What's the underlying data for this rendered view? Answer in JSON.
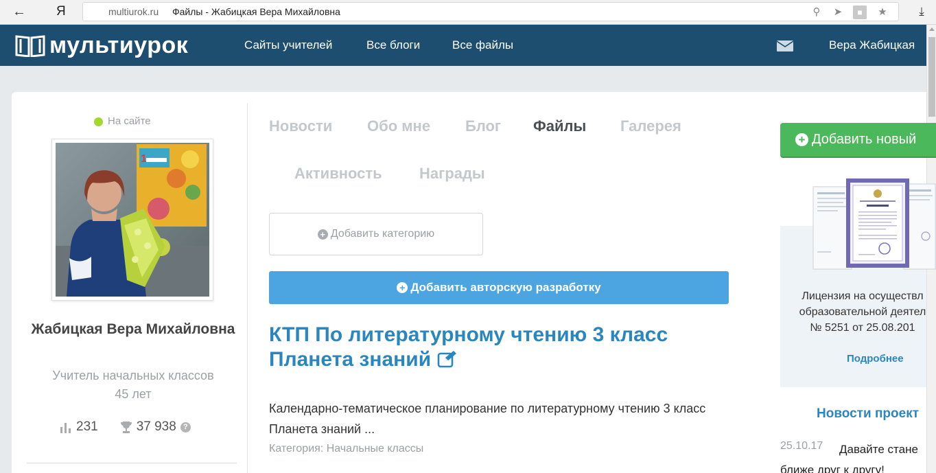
{
  "browser": {
    "back_icon": "arrow-left-icon",
    "yandex_label": "Я",
    "domain": "multiurok.ru",
    "page_title": "Файлы - Жабицкая Вера Михайловна",
    "download_icon": "download-icon"
  },
  "navbar": {
    "logo": "мультиурок",
    "links": [
      "Сайты учителей",
      "Все блоги",
      "Все файлы"
    ],
    "user": "Вера Жабицкая",
    "color": "#1d4e6f"
  },
  "profile": {
    "status": "На сайте",
    "name": "Жабицкая Вера Михайловна",
    "role": "Учитель начальных классов",
    "age": "45 лет",
    "rating": "231",
    "awards": "37 938",
    "help_glyph": "?"
  },
  "tabs": [
    "Новости",
    "Обо мне",
    "Блог",
    "Файлы",
    "Галерея",
    "Активность",
    "Награды"
  ],
  "active_tab": "Файлы",
  "actions": {
    "add_category": "Добавить категорию",
    "add_development": "Добавить авторскую разработку",
    "add_new": "Добавить новый"
  },
  "post": {
    "title": "КТП По литературному чтению 3 класс Планета знаний",
    "description": "Календарно-тематическое планирование по литературному чтению 3 класс Планета знаний ...",
    "category": "Категория: Начальные классы"
  },
  "sidebar": {
    "license_line1": "Лицензия на осуществл",
    "license_line2": "образовательной деятел",
    "license_line3": "№ 5251 от 25.08.201",
    "license_more": "Подробнее",
    "news_title": "Новости проект",
    "news_date": "25.10.17",
    "news_text1": "Давайте стане",
    "news_text2": "ближе друг к другу!"
  },
  "colors": {
    "accent_blue": "#4ca5e0",
    "link_blue": "#2a86bf",
    "green": "#4cb85c",
    "online_green": "#a3d82d"
  }
}
